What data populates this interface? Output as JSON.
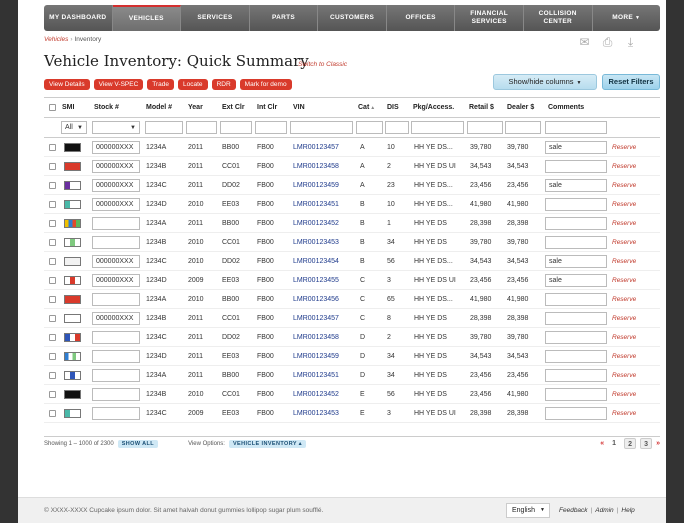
{
  "nav": [
    "MY DASHBOARD",
    "VEHICLES",
    "SERVICES",
    "PARTS",
    "CUSTOMERS",
    "OFFICES",
    "FINANCIAL SERVICES",
    "COLLISION CENTER",
    "MORE"
  ],
  "breadcrumb": {
    "root": "Vehicles",
    "current": "Inventory"
  },
  "page": {
    "title": "Vehicle Inventory: Quick Summary",
    "switch_link": "Switch to Classic"
  },
  "actions": [
    "View Details",
    "View V-SPEC",
    "Trade",
    "Locate",
    "RDR",
    "Mark for demo"
  ],
  "toolbar": {
    "show_hide": "Show/hide columns",
    "reset": "Reset Filters"
  },
  "columns": [
    "SMI",
    "Stock #",
    "Model #",
    "Year",
    "Ext Clr",
    "Int Clr",
    "VIN",
    "Cat",
    "DIS",
    "Pkg/Access.",
    "Retail $",
    "Dealer $",
    "Comments"
  ],
  "filter": {
    "smi": "All"
  },
  "rows": [
    {
      "swatch": [
        "#111111"
      ],
      "stock": "000000XXX",
      "model": "1234A",
      "year": "2011",
      "ext": "BB00",
      "int": "FB00",
      "vin": "LMR00123457",
      "cat": "A",
      "dis": "10",
      "pkg": "HH YE DS...",
      "retail": "39,780",
      "dealer": "39,780",
      "comment": "sale",
      "action": "Reserve"
    },
    {
      "swatch": [
        "#d93a2b"
      ],
      "stock": "000000XXX",
      "model": "1234B",
      "year": "2011",
      "ext": "CC01",
      "int": "FB00",
      "vin": "LMR00123458",
      "cat": "A",
      "dis": "2",
      "pkg": "HH YE DS UI",
      "retail": "34,543",
      "dealer": "34,543",
      "comment": "",
      "action": "Reserve"
    },
    {
      "swatch": [
        "#6a2fa0",
        "#ffffff",
        "#ffffff"
      ],
      "stock": "000000XXX",
      "model": "1234C",
      "year": "2011",
      "ext": "DD02",
      "int": "FB00",
      "vin": "LMR00123459",
      "cat": "A",
      "dis": "23",
      "pkg": "HH YE DS...",
      "retail": "23,456",
      "dealer": "23,456",
      "comment": "sale",
      "action": "Reserve"
    },
    {
      "swatch": [
        "#49b8a8",
        "#ffffff",
        "#ffffff"
      ],
      "stock": "000000XXX",
      "model": "1234D",
      "year": "2010",
      "ext": "EE03",
      "int": "FB00",
      "vin": "LMR00123451",
      "cat": "B",
      "dis": "10",
      "pkg": "HH YE DS...",
      "retail": "41,980",
      "dealer": "41,980",
      "comment": "",
      "action": "Reserve"
    },
    {
      "swatch": [
        "#f0c000",
        "#2e7dd1",
        "#e24a2a",
        "#5cb85c"
      ],
      "stock": "",
      "model": "1234A",
      "year": "2011",
      "ext": "BB00",
      "int": "FB00",
      "vin": "LMR00123452",
      "cat": "B",
      "dis": "1",
      "pkg": "HH YE DS",
      "retail": "28,398",
      "dealer": "28,398",
      "comment": "",
      "action": "Reserve"
    },
    {
      "swatch": [
        "#ffffff",
        "#7fc97f",
        "#ffffff"
      ],
      "stock": "",
      "model": "1234B",
      "year": "2010",
      "ext": "CC01",
      "int": "FB00",
      "vin": "LMR00123453",
      "cat": "B",
      "dis": "34",
      "pkg": "HH YE DS",
      "retail": "39,780",
      "dealer": "39,780",
      "comment": "",
      "action": "Reserve"
    },
    {
      "swatch": [
        "#f2f2f2"
      ],
      "stock": "000000XXX",
      "model": "1234C",
      "year": "2010",
      "ext": "DD02",
      "int": "FB00",
      "vin": "LMR00123454",
      "cat": "B",
      "dis": "56",
      "pkg": "HH YE DS...",
      "retail": "34,543",
      "dealer": "34,543",
      "comment": "sale",
      "action": "Reserve"
    },
    {
      "swatch": [
        "#ffffff",
        "#d93a2b",
        "#ffffff"
      ],
      "stock": "000000XXX",
      "model": "1234D",
      "year": "2009",
      "ext": "EE03",
      "int": "FB00",
      "vin": "LMR00123455",
      "cat": "C",
      "dis": "3",
      "pkg": "HH YE DS UI",
      "retail": "23,456",
      "dealer": "23,456",
      "comment": "sale",
      "action": "Reserve"
    },
    {
      "swatch": [
        "#d93a2b"
      ],
      "stock": "",
      "model": "1234A",
      "year": "2010",
      "ext": "BB00",
      "int": "FB00",
      "vin": "LMR00123456",
      "cat": "C",
      "dis": "65",
      "pkg": "HH YE DS...",
      "retail": "41,980",
      "dealer": "41,980",
      "comment": "",
      "action": "Reserve"
    },
    {
      "swatch": [
        "#ffffff"
      ],
      "stock": "000000XXX",
      "model": "1234B",
      "year": "2011",
      "ext": "CC01",
      "int": "FB00",
      "vin": "LMR00123457",
      "cat": "C",
      "dis": "8",
      "pkg": "HH YE DS",
      "retail": "28,398",
      "dealer": "28,398",
      "comment": "",
      "action": "Reserve"
    },
    {
      "swatch": [
        "#2e55b8",
        "#ffffff",
        "#d93a2b"
      ],
      "stock": "",
      "model": "1234C",
      "year": "2011",
      "ext": "DD02",
      "int": "FB00",
      "vin": "LMR00123458",
      "cat": "D",
      "dis": "2",
      "pkg": "HH YE DS",
      "retail": "39,780",
      "dealer": "39,780",
      "comment": "",
      "action": "Reserve"
    },
    {
      "swatch": [
        "#2e7dd1",
        "#ffffff",
        "#7fc97f",
        "#ffffff"
      ],
      "stock": "",
      "model": "1234D",
      "year": "2011",
      "ext": "EE03",
      "int": "FB00",
      "vin": "LMR00123459",
      "cat": "D",
      "dis": "34",
      "pkg": "HH YE DS",
      "retail": "34,543",
      "dealer": "34,543",
      "comment": "",
      "action": "Reserve"
    },
    {
      "swatch": [
        "#ffffff",
        "#2e55b8",
        "#ffffff"
      ],
      "stock": "",
      "model": "1234A",
      "year": "2011",
      "ext": "BB00",
      "int": "FB00",
      "vin": "LMR00123451",
      "cat": "D",
      "dis": "34",
      "pkg": "HH YE DS",
      "retail": "23,456",
      "dealer": "23,456",
      "comment": "",
      "action": "Reserve"
    },
    {
      "swatch": [
        "#111111"
      ],
      "stock": "",
      "model": "1234B",
      "year": "2010",
      "ext": "CC01",
      "int": "FB00",
      "vin": "LMR00123452",
      "cat": "E",
      "dis": "56",
      "pkg": "HH YE DS",
      "retail": "23,456",
      "dealer": "41,980",
      "comment": "",
      "action": "Reserve"
    },
    {
      "swatch": [
        "#49b8a8",
        "#ffffff",
        "#ffffff"
      ],
      "stock": "",
      "model": "1234C",
      "year": "2009",
      "ext": "EE03",
      "int": "FB00",
      "vin": "LMR00123453",
      "cat": "E",
      "dis": "3",
      "pkg": "HH YE DS UI",
      "retail": "28,398",
      "dealer": "28,398",
      "comment": "",
      "action": "Reserve"
    }
  ],
  "footer": {
    "showing": "Showing 1 – 1000 of 2300",
    "show_all": "SHOW ALL",
    "view_options": "View Options:",
    "view_tag": "VEHICLE INVENTORY ▴",
    "pages": [
      "1",
      "2",
      "3"
    ],
    "prev": "«",
    "next": "»"
  },
  "copyright": "© XXXX-XXXX Cupcake ipsum dolor. Sit amet halvah donut gummies lollipop sugar plum soufflé.",
  "language": "English",
  "bottom_links": [
    "Feedback",
    "Admin",
    "Help"
  ],
  "colors": {
    "accent": "#d93a2b",
    "link": "#1f3b8c",
    "nav": "#5f5f5f"
  }
}
